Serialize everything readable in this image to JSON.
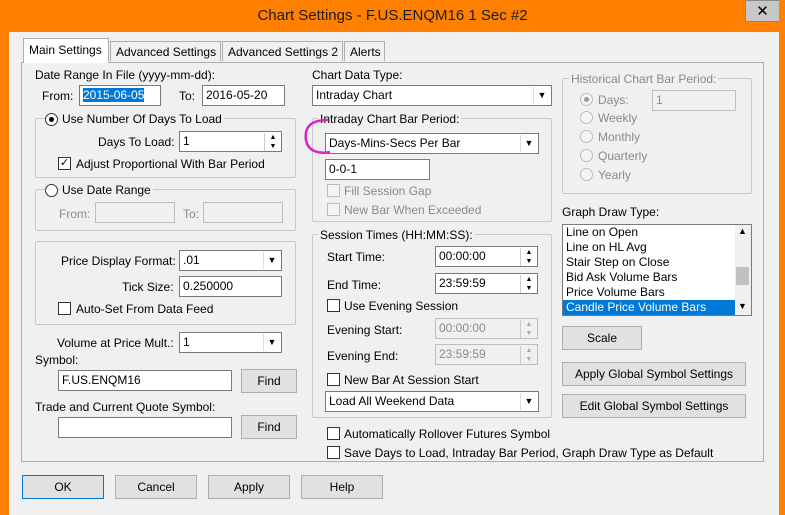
{
  "window": {
    "title": "Chart Settings - F.US.ENQM16  1 Sec   #2",
    "close_glyph": "✕"
  },
  "tabs": [
    {
      "label": "Main Settings"
    },
    {
      "label": "Advanced Settings"
    },
    {
      "label": "Advanced Settings 2"
    },
    {
      "label": "Alerts"
    }
  ],
  "left": {
    "date_range_label": "Date Range In File (yyyy-mm-dd):",
    "from_label": "From:",
    "from_value": "2015-06-05",
    "to_label": "To:",
    "to_value": "2016-05-20",
    "use_days_label": "Use Number Of Days To Load",
    "days_to_load_label": "Days To Load:",
    "days_to_load_value": "1",
    "adjust_label": "Adjust Proportional With Bar Period",
    "use_date_range_label": "Use Date Range",
    "range_from_label": "From:",
    "range_to_label": "To:",
    "price_format_label": "Price Display Format:",
    "price_format_value": ".01",
    "tick_size_label": "Tick Size:",
    "tick_size_value": "0.250000",
    "autoset_label": "Auto-Set From Data Feed",
    "vol_mult_label": "Volume at Price Mult.:",
    "vol_mult_value": "1",
    "symbol_label": "Symbol:",
    "symbol_value": "F.US.ENQM16",
    "find_label": "Find",
    "trade_symbol_label": "Trade and Current Quote Symbol:",
    "trade_symbol_value": "",
    "find2_label": "Find"
  },
  "middle": {
    "data_type_label": "Chart Data Type:",
    "data_type_value": "Intraday Chart",
    "intraday_group_label": "Intraday Chart Bar Period:",
    "bar_period_type": "Days-Mins-Secs Per Bar",
    "bar_period_value": "0-0-1",
    "fill_gap_label": "Fill Session Gap",
    "new_bar_exceeded_label": "New Bar When Exceeded",
    "session_group_label": "Session Times (HH:MM:SS):",
    "start_time_label": "Start Time:",
    "start_time_value": "00:00:00",
    "end_time_label": "End Time:",
    "end_time_value": "23:59:59",
    "use_evening_label": "Use Evening Session",
    "evening_start_label": "Evening Start:",
    "evening_start_value": "00:00:00",
    "evening_end_label": "Evening End:",
    "evening_end_value": "23:59:59",
    "new_bar_session_label": "New Bar At Session Start",
    "weekend_value": "Load All Weekend Data",
    "auto_rollover_label": "Automatically Rollover Futures Symbol",
    "save_days_label": "Save Days to Load, Intraday Bar Period, Graph Draw Type as Default"
  },
  "right": {
    "hist_group_label": "Historical Chart Bar Period:",
    "days_label": "Days:",
    "days_value": "1",
    "weekly_label": "Weekly",
    "monthly_label": "Monthly",
    "quarterly_label": "Quarterly",
    "yearly_label": "Yearly",
    "graph_draw_label": "Graph Draw Type:",
    "graph_draw_items": [
      "Line on Open",
      "Line on HL Avg",
      "Stair Step on Close",
      "Bid Ask Volume Bars",
      "Price Volume Bars",
      "Candle Price Volume Bars"
    ],
    "graph_draw_selected": "Candle Price Volume Bars",
    "scale_label": "Scale",
    "apply_global_label": "Apply Global Symbol Settings",
    "edit_global_label": "Edit Global Symbol Settings"
  },
  "bottom": {
    "ok_label": "OK",
    "cancel_label": "Cancel",
    "apply_label": "Apply",
    "help_label": "Help"
  },
  "colors": {
    "frame_orange": "#ff8000",
    "selection_blue": "#0078d7",
    "annotation_magenta": "#e020c8"
  }
}
